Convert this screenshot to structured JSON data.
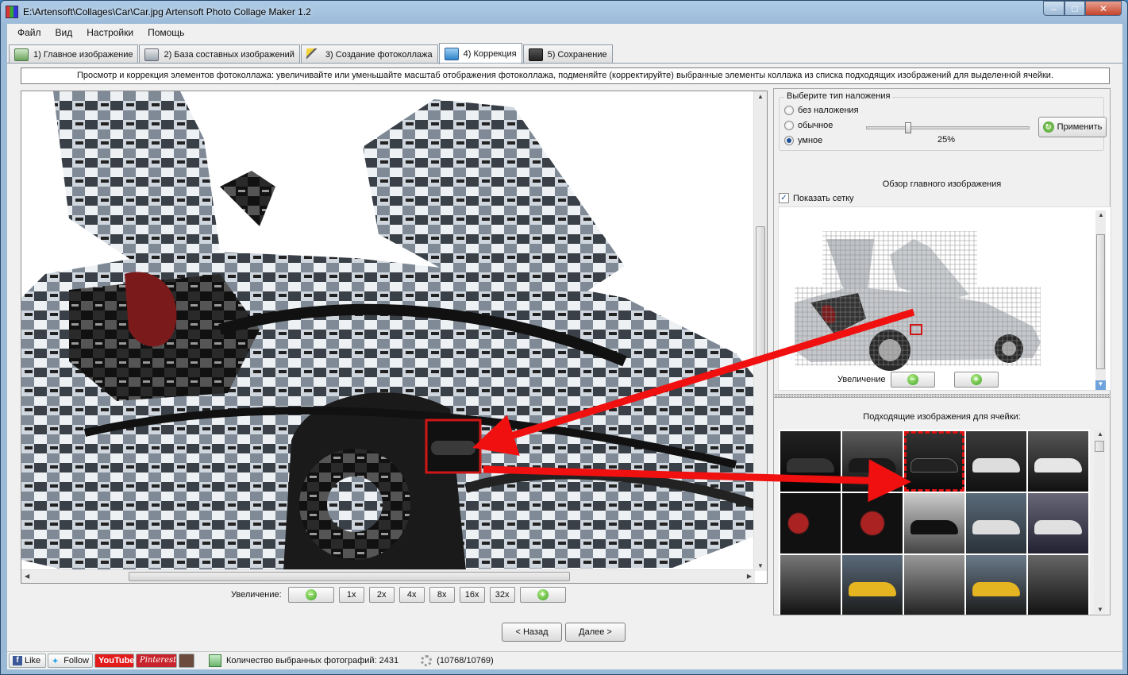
{
  "window": {
    "title": "E:\\Artensoft\\Collages\\Car\\Car.jpg Artensoft Photo Collage Maker 1.2",
    "min_glyph": "–",
    "max_glyph": "□",
    "close_glyph": "✕"
  },
  "menu": [
    "Файл",
    "Вид",
    "Настройки",
    "Помощь"
  ],
  "tabs": [
    {
      "label": "1) Главное изображение",
      "icon": "image-icon"
    },
    {
      "label": "2) База составных изображений",
      "icon": "database-icon"
    },
    {
      "label": "3) Создание фотоколлажа",
      "icon": "magic-wand-icon"
    },
    {
      "label": "4) Коррекция",
      "icon": "cube-icon",
      "active": true
    },
    {
      "label": "5) Сохранение",
      "icon": "floppy-icon"
    }
  ],
  "hint": "Просмотр и коррекция элементов фотоколлажа: увеличивайте или уменьшайте масштаб отображения фотоколлажа, подменяйте (корректируйте) выбранные элементы коллажа из списка подходящих изображений для выделенной ячейки.",
  "zoom": {
    "label": "Увеличение:",
    "levels": [
      "1x",
      "2x",
      "4x",
      "8x",
      "16x",
      "32x"
    ]
  },
  "overlay": {
    "title": "Выберите тип наложения",
    "options": [
      "без наложения",
      "обычное",
      "умное"
    ],
    "selected": "умное",
    "percent": "25%",
    "percent_value": 0.25,
    "apply_label": "Применить"
  },
  "overview": {
    "title": "Обзор главного изображения",
    "show_grid_label": "Показать сетку",
    "show_grid_checked": true,
    "zoom_label": "Увеличение"
  },
  "matching": {
    "title": "Подходящие изображения для ячейки:"
  },
  "nav": {
    "back": "< Назад",
    "next": "Далее >"
  },
  "status": {
    "like": "Like",
    "follow": "Follow",
    "youtube": "YouTube",
    "pinterest": "Pinterest",
    "count_label": "Количество выбранных фотографий: 2431",
    "progress": "(10768/10769)"
  }
}
